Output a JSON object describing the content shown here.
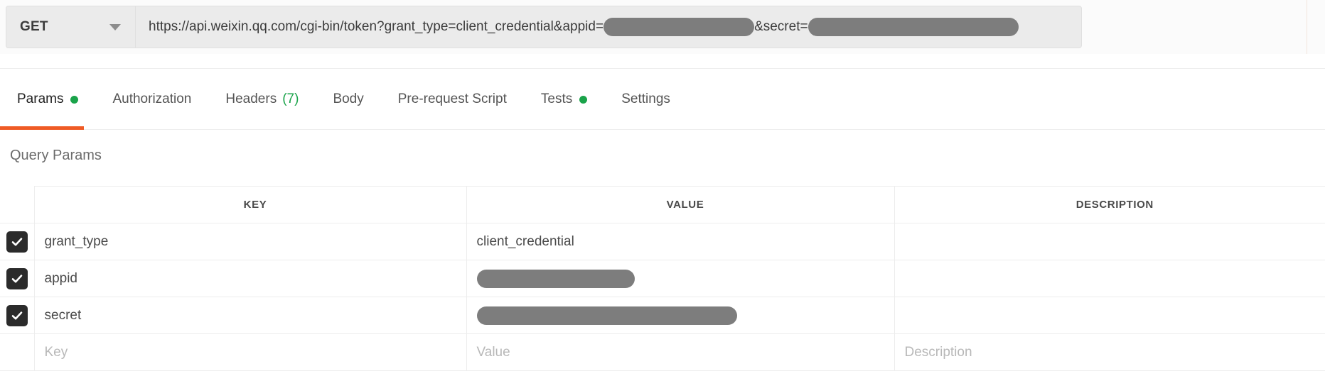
{
  "request_bar": {
    "method": "GET",
    "method_caret_icon": "chevron-down-icon",
    "url_prefix": "https://api.weixin.qq.com/cgi-bin/token?grant_type=client_credential&appid=",
    "url_middle": "&secret=",
    "url_suffix": "",
    "appid_redacted_width": 212,
    "secret_redacted_width": 296,
    "send_button_color": "#0a7cdb"
  },
  "tabs": [
    {
      "label": "Params",
      "dot": true,
      "count": "",
      "active": true
    },
    {
      "label": "Authorization",
      "dot": false,
      "count": "",
      "active": false
    },
    {
      "label": "Headers",
      "dot": false,
      "count": "(7)",
      "active": false
    },
    {
      "label": "Body",
      "dot": false,
      "count": "",
      "active": false
    },
    {
      "label": "Pre-request Script",
      "dot": false,
      "count": "",
      "active": false
    },
    {
      "label": "Tests",
      "dot": true,
      "count": "",
      "active": false
    },
    {
      "label": "Settings",
      "dot": false,
      "count": "",
      "active": false
    }
  ],
  "accent_color": "#ef5b25",
  "dot_color": "#1aa34a",
  "params": {
    "section_title": "Query Params",
    "columns": [
      "KEY",
      "VALUE",
      "DESCRIPTION"
    ],
    "rows": [
      {
        "checked": true,
        "key": "grant_type",
        "value": "client_credential",
        "value_redacted": false,
        "value_redact_width": 0,
        "description": ""
      },
      {
        "checked": true,
        "key": "appid",
        "value": "",
        "value_redacted": true,
        "value_redact_width": 222,
        "description": ""
      },
      {
        "checked": true,
        "key": "secret",
        "value": "",
        "value_redacted": true,
        "value_redact_width": 366,
        "description": ""
      }
    ],
    "new_row": {
      "key_placeholder": "Key",
      "value_placeholder": "Value",
      "description_placeholder": "Description"
    }
  }
}
